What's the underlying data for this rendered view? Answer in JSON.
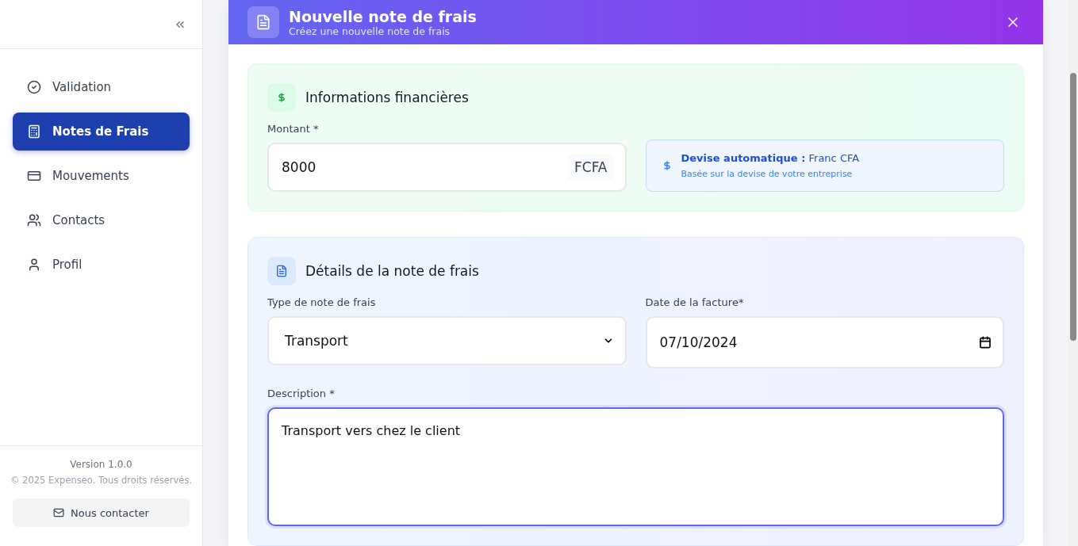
{
  "sidebar": {
    "items": [
      {
        "label": "Validation",
        "selected": false
      },
      {
        "label": "Notes de Frais",
        "selected": true
      },
      {
        "label": "Mouvements",
        "selected": false
      },
      {
        "label": "Contacts",
        "selected": false
      },
      {
        "label": "Profil",
        "selected": false
      }
    ],
    "footer": {
      "version": "Version 1.0.0",
      "copyright": "© 2025 Expenseo. Tous droits réservés.",
      "contact_button": "Nous contacter"
    }
  },
  "modal": {
    "title": "Nouvelle note de frais",
    "subtitle": "Créez une nouvelle note de frais",
    "financial": {
      "title": "Informations financières",
      "amount_label": "Montant *",
      "amount_value": "8000",
      "currency_suffix": "FCFA",
      "currency_note": {
        "label": "**Devise automatique :** Franc CFA",
        "hint": "Basée sur la devise de votre entreprise"
      }
    },
    "details": {
      "title": "Détails de la note de frais",
      "type_label": "Type de note de frais",
      "type_value": "Transport",
      "date_label": "Date de la facture*",
      "date_value": "07/10/2024",
      "description_label": "Description *",
      "description_value": "Transport vers chez le client",
      "description_focused": true
    }
  }
}
